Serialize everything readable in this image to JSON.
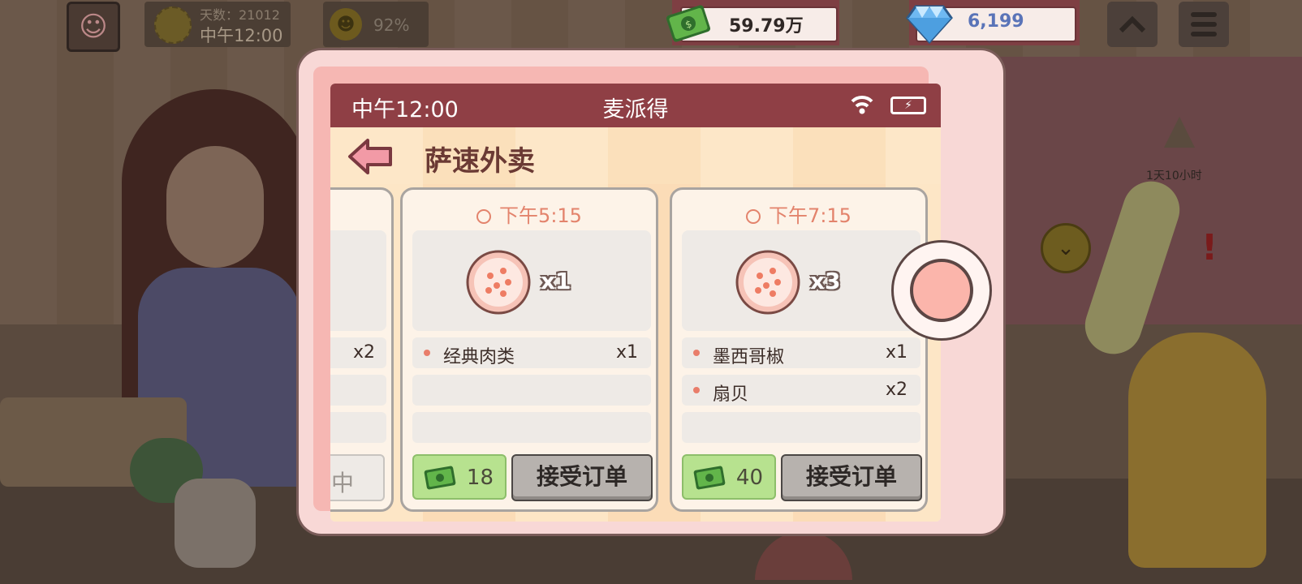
{
  "hud": {
    "day_label": "天数：21012",
    "time": "中午12:00",
    "mood_percent": "92%",
    "money": "59.79万",
    "gems": "6,199",
    "event_timer": "1天10小时",
    "icons": [
      "avatar-icon",
      "sun-icon",
      "mood-face-icon",
      "money-icon",
      "gem-icon",
      "up-arrow-icon",
      "menu-icon",
      "campfire-icon",
      "scroll-down-icon",
      "alert-icon"
    ]
  },
  "phone": {
    "status": {
      "time": "中午12:00",
      "app_name": "麦派得"
    },
    "page_title": "萨速外卖",
    "partial_card": {
      "count": "x2",
      "button": "中"
    },
    "orders": [
      {
        "deadline": "下午5:15",
        "pizza_qty": "x1",
        "items": [
          {
            "name": "经典肉类",
            "count": "x1"
          }
        ],
        "reward": "18",
        "accept_label": "接受订单"
      },
      {
        "deadline": "下午7:15",
        "pizza_qty": "x3",
        "items": [
          {
            "name": "墨西哥椒",
            "count": "x1"
          },
          {
            "name": "扇贝",
            "count": "x2"
          }
        ],
        "reward": "40",
        "accept_label": "接受订单"
      }
    ]
  },
  "colors": {
    "status_bar": "#8f3f45",
    "accent_text": "#e3836c",
    "reward_green": "#b7e28f",
    "button_gray": "#b7b2ae"
  }
}
